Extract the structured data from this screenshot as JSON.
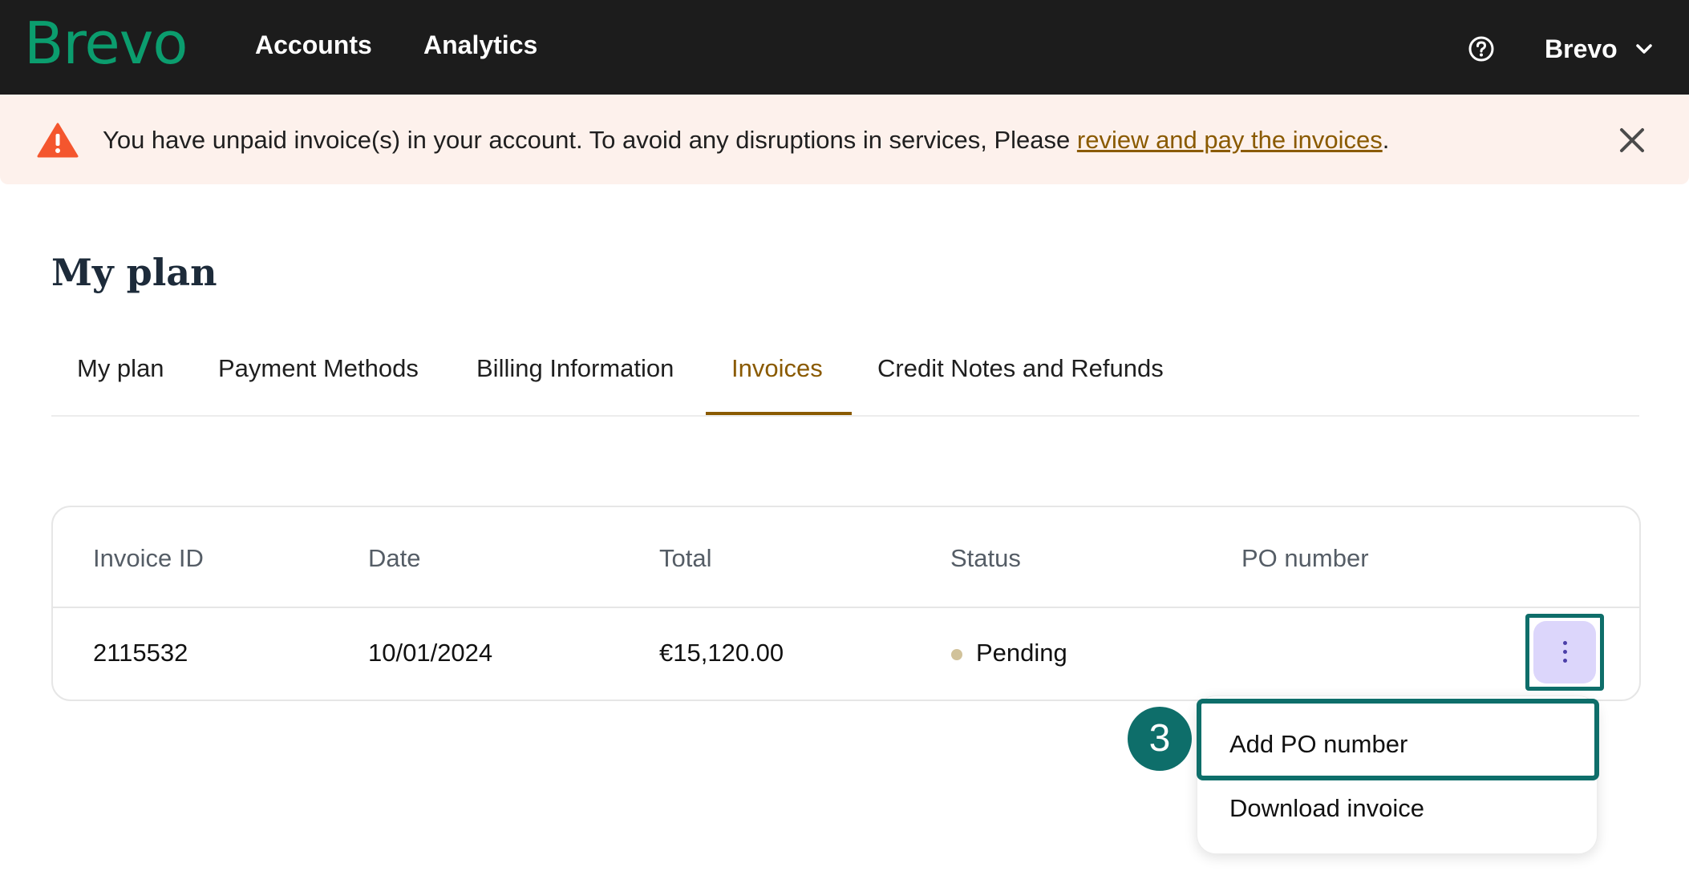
{
  "topbar": {
    "logo": "Brevo",
    "nav": [
      "Accounts",
      "Analytics"
    ],
    "help_icon": "question-circle-icon",
    "account_label": "Brevo",
    "account_chevron_icon": "chevron-down-icon"
  },
  "banner": {
    "icon": "warning-triangle-icon",
    "text_before": "You have unpaid invoice(s) in your account. To avoid any disruptions in services, Please ",
    "link_text": "review and pay the invoices",
    "text_after": ".",
    "close_icon": "close-icon",
    "background": "#fdf1ec",
    "warning_color": "#f4562e"
  },
  "page": {
    "title": "My plan"
  },
  "tabs": [
    {
      "label": "My plan",
      "active": false
    },
    {
      "label": "Payment Methods",
      "active": false
    },
    {
      "label": "Billing Information",
      "active": false
    },
    {
      "label": "Invoices",
      "active": true
    },
    {
      "label": "Credit Notes and Refunds",
      "active": false
    }
  ],
  "invoices_table": {
    "columns": [
      "Invoice ID",
      "Date",
      "Total",
      "Status",
      "PO number"
    ],
    "rows": [
      {
        "invoice_id": "2115532",
        "date": "10/01/2024",
        "total": "€15,120.00",
        "status": "Pending",
        "po_number": ""
      }
    ],
    "row_action_icon": "kebab-menu-icon"
  },
  "row_menu": {
    "items": [
      "Add PO number",
      "Download invoice"
    ]
  },
  "annotation": {
    "step_number": "3",
    "color": "#0e6e6a"
  },
  "colors": {
    "brand_green": "#0b9d6e",
    "topbar": "#1c1c1c",
    "active_tab": "#8a5a00",
    "kebab_bg": "#dcd6fb",
    "status_pending": "#d1c29a"
  }
}
